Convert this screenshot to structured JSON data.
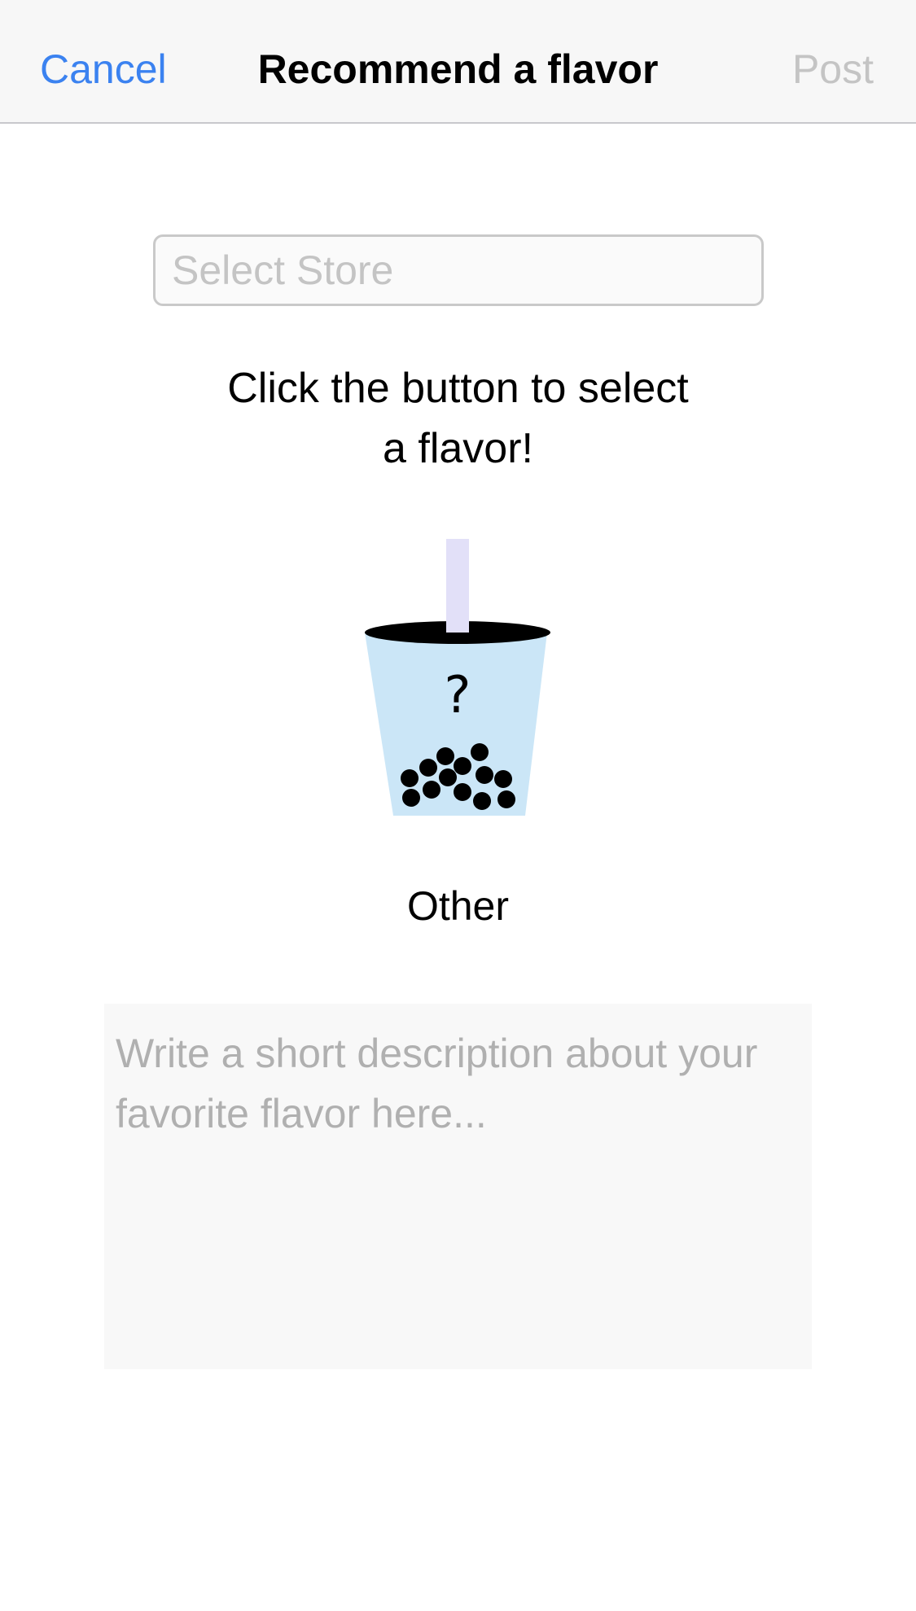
{
  "navbar": {
    "cancel_label": "Cancel",
    "title": "Recommend a flavor",
    "post_label": "Post"
  },
  "store": {
    "placeholder": "Select Store",
    "value": ""
  },
  "instruction": {
    "line1": "Click the button to select",
    "line2": "a flavor!"
  },
  "flavor": {
    "icon": "bubble-tea-cup-icon",
    "question_mark": "?",
    "name": "Other"
  },
  "description": {
    "placeholder": "Write a short description about your favorite flavor here...",
    "value": ""
  },
  "colors": {
    "accent": "#3b82f0",
    "disabled": "#c4c4c4",
    "cup_fill": "#cbe6f7",
    "straw": "#e2e0f8",
    "pearls": "#000000"
  }
}
